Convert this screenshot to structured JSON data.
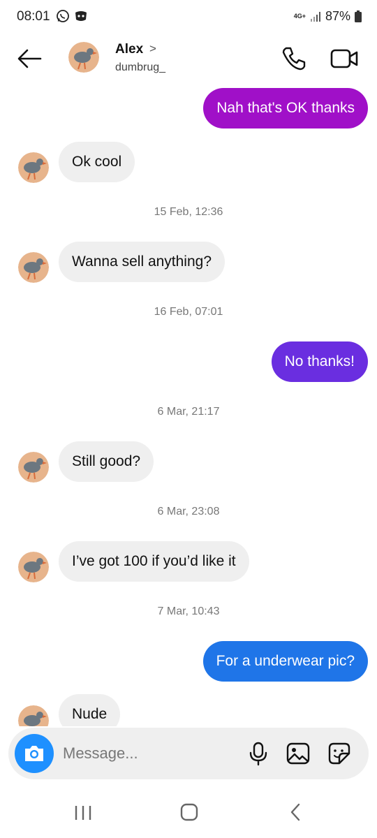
{
  "status_bar": {
    "time": "08:01",
    "network": "4G+",
    "battery": "87%",
    "icons": [
      "whatsapp-icon",
      "discord-icon",
      "signal-icon",
      "battery-icon"
    ]
  },
  "header": {
    "name": "Alex",
    "chevron": ">",
    "username": "dumbrug_",
    "icons": [
      "back-arrow-icon",
      "phone-icon",
      "video-camera-icon"
    ]
  },
  "messages": [
    {
      "dir": "out",
      "text": "Nah that's OK thanks",
      "color": "#a010c8"
    },
    {
      "dir": "in",
      "text": "Ok cool"
    },
    {
      "timestamp": "15 Feb, 12:36"
    },
    {
      "dir": "in",
      "text": "Wanna sell anything?"
    },
    {
      "timestamp": "16 Feb, 07:01"
    },
    {
      "dir": "out",
      "text": "No thanks!",
      "color": "#6a2ee0"
    },
    {
      "timestamp": "6 Mar, 21:17"
    },
    {
      "dir": "in",
      "text": "Still good?"
    },
    {
      "timestamp": "6 Mar, 23:08"
    },
    {
      "dir": "in",
      "text": "I’ve got 100 if you’d like it"
    },
    {
      "timestamp": "7 Mar, 10:43"
    },
    {
      "dir": "out",
      "text": "For a underwear pic?",
      "color": "#1f75e8"
    },
    {
      "dir": "in",
      "text": "Nude"
    }
  ],
  "composer": {
    "placeholder": "Message...",
    "icons": [
      "camera-icon",
      "microphone-icon",
      "gallery-icon",
      "sticker-icon"
    ],
    "camera_color": "#1e90ff"
  },
  "nav": {
    "icons": [
      "recent-apps-icon",
      "home-icon",
      "back-icon"
    ]
  }
}
